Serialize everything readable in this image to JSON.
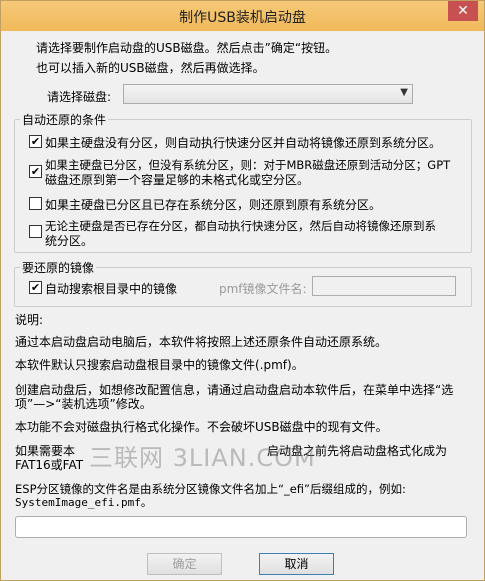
{
  "window": {
    "title": "制作USB装机启动盘",
    "close_glyph": "✕"
  },
  "intro": {
    "line1": "请选择要制作启动盘的USB磁盘。然后点击”确定“按钮。",
    "line2": "也可以插入新的USB磁盘，然后再做选择。"
  },
  "disk_select": {
    "label": "请选择磁盘:",
    "value": ""
  },
  "restore_group": {
    "title": "自动还原的条件",
    "options": [
      {
        "checked": true,
        "line1": "如果主硬盘没有分区，则自动执行快速分区并自动将镜像还原到系统分区。",
        "line2": ""
      },
      {
        "checked": true,
        "line1": "如果主硬盘已分区，但没有系统分区，则：对于MBR磁盘还原到活动分区；GPT",
        "line2": "磁盘还原到第一个容量足够的未格式化或空分区。"
      },
      {
        "checked": false,
        "line1": "如果主硬盘已分区且已存在系统分区，则还原到原有系统分区。",
        "line2": ""
      },
      {
        "checked": false,
        "line1": "无论主硬盘是否已存在分区，都自动执行快速分区，然后自动将镜像还原到系",
        "line2": "统分区。"
      }
    ]
  },
  "image_group": {
    "title": "要还原的镜像",
    "auto_search_label": "自动搜索根目录中的镜像",
    "auto_search_checked": true,
    "pmf_label": "pmf镜像文件名:",
    "pmf_value": ""
  },
  "description": {
    "heading": "说明:",
    "p1": "通过本启动盘启动电脑后，本软件将按照上述还原条件自动还原系统。",
    "p2": "本软件默认只搜索启动盘根目录中的镜像文件(.pmf)。",
    "p3_line1": "创建启动盘后，如想修改配置信息，请通过启动盘启动本软件后，在菜单中选择“选",
    "p3_line2": "项”—>“装机选项”修改。",
    "p4": "本功能不会对磁盘执行格式化操作。不会破坏USB磁盘中的现有文件。",
    "p5_line1": "如果需要本",
    "p5_line1b": "启动盘之前先将启动盘格式化成为",
    "p5_line2": "FAT16或FAT",
    "p6_line1": "ESP分区镜像的文件名是由系统分区镜像文件名加上“_efi”后缀组成的，例如:",
    "p6_line2": "SystemImage_efi.pmf。"
  },
  "watermark": "三联网 3LIAN.COM",
  "progress": {
    "value": ""
  },
  "buttons": {
    "ok": "确定",
    "cancel": "取消"
  }
}
